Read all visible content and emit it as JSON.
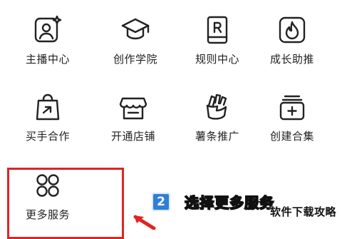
{
  "grid": {
    "items": [
      {
        "label": "主播中心",
        "icon": "anchor-center-icon"
      },
      {
        "label": "创作学院",
        "icon": "graduation-cap-icon"
      },
      {
        "label": "规则中心",
        "icon": "rules-book-icon"
      },
      {
        "label": "成长助推",
        "icon": "flame-icon"
      },
      {
        "label": "买手合作",
        "icon": "shopping-bag-icon"
      },
      {
        "label": "开通店铺",
        "icon": "store-icon"
      },
      {
        "label": "薯条推广",
        "icon": "fries-icon"
      },
      {
        "label": "创建合集",
        "icon": "collection-add-icon"
      },
      {
        "label": "更多服务",
        "icon": "four-circles-icon"
      }
    ]
  },
  "callout": {
    "step_number": "2",
    "text": "选择更多服务"
  },
  "watermark": "软件下载攻略",
  "colors": {
    "highlight": "#e02424",
    "step_badge": "#2f7fd6",
    "icon_stroke": "#222222"
  }
}
